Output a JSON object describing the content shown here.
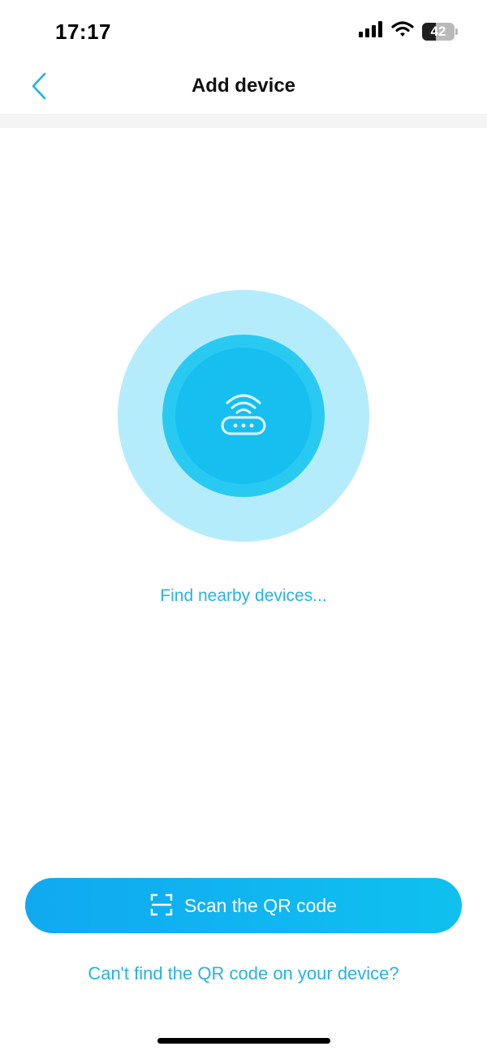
{
  "status_bar": {
    "time": "17:17",
    "battery": "42",
    "battery_fraction": 0.42,
    "icons": [
      "cellular-signal-icon",
      "wifi-icon",
      "battery-icon"
    ]
  },
  "header": {
    "back_icon": "chevron-left-icon",
    "title": "Add device"
  },
  "scanner": {
    "icon": "router-wifi-icon",
    "message": "Find nearby devices..."
  },
  "actions": {
    "scan_icon": "qr-scan-frame-icon",
    "scan_label": "Scan the QR code",
    "help_link": "Can't find the QR code on your device?"
  },
  "colors": {
    "accent": "#27b3e3",
    "button_start": "#10a9f1",
    "button_end": "#0fc1ef",
    "pulse_outer": "#b5ecfb",
    "pulse_mid": "#29caf2",
    "pulse_inner": "#16bff0"
  }
}
